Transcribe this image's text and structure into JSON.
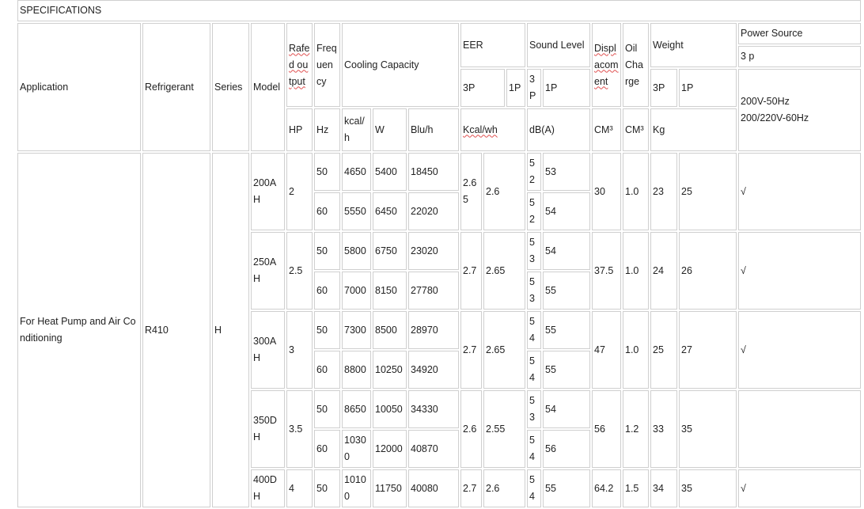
{
  "title": "SPECIFICATIONS",
  "headers": {
    "application": "Application",
    "refrigerant": "Refrigerant",
    "series": "Series",
    "model": "Model",
    "rated_output": "Rafed output",
    "frequency": "Frequency",
    "cooling_capacity": "Cooling Capacity",
    "eer": "EER",
    "eer_3p": "3P",
    "eer_1p": "1P",
    "sound_level": "Sound Level",
    "sound_3p": "3P",
    "sound_1p": "1P",
    "displacement": "Displacoment",
    "oil_charge": "Oil Charge",
    "weight": "Weight",
    "weight_3p": "3P",
    "weight_1p": "1P",
    "power_source": "Power Source",
    "power_phase": "3 p",
    "power_voltage_1": "200V-50Hz",
    "power_voltage_2": "200/220V-60Hz"
  },
  "units": {
    "hp": "HP",
    "hz": "Hz",
    "kcal": "kcal/h",
    "w": "W",
    "btu": "Blu/h",
    "eer": "Kcal/wh",
    "sound": "dB(A)",
    "displ": "CM³",
    "oil": "CM³",
    "weight": "Kg"
  },
  "application": "For Heat Pump and Air Conditioning",
  "refrigerant": "R410",
  "series": "H",
  "models": [
    {
      "model": "200AH",
      "hp": "2",
      "eer3": "2.65",
      "eer1": "2.6",
      "displ": "30",
      "oil": "1.0",
      "w3": "23",
      "w1": "25",
      "power": "√",
      "rows": [
        {
          "hz": "50",
          "kcal": "4650",
          "w": "5400",
          "btu": "18450",
          "s3": "52",
          "s1": "53"
        },
        {
          "hz": "60",
          "kcal": "5550",
          "w": "6450",
          "btu": "22020",
          "s3": "52",
          "s1": "54"
        }
      ]
    },
    {
      "model": "250AH",
      "hp": "2.5",
      "eer3": "2.7",
      "eer1": "2.65",
      "displ": "37.5",
      "oil": "1.0",
      "w3": "24",
      "w1": "26",
      "power": "√",
      "rows": [
        {
          "hz": "50",
          "kcal": "5800",
          "w": "6750",
          "btu": "23020",
          "s3": "53",
          "s1": "54"
        },
        {
          "hz": "60",
          "kcal": "7000",
          "w": "8150",
          "btu": "27780",
          "s3": "53",
          "s1": "55"
        }
      ]
    },
    {
      "model": "300AH",
      "hp": "3",
      "eer3": "2.7",
      "eer1": "2.65",
      "displ": "47",
      "oil": "1.0",
      "w3": "25",
      "w1": "27",
      "power": "√",
      "rows": [
        {
          "hz": "50",
          "kcal": "7300",
          "w": "8500",
          "btu": "28970",
          "s3": "54",
          "s1": "55"
        },
        {
          "hz": "60",
          "kcal": "8800",
          "w": "10250",
          "btu": "34920",
          "s3": "54",
          "s1": "55"
        }
      ]
    },
    {
      "model": "350DH",
      "hp": "3.5",
      "eer3": "2.6",
      "eer1": "2.55",
      "displ": "56",
      "oil": "1.2",
      "w3": "33",
      "w1": "35",
      "power": "",
      "rows": [
        {
          "hz": "50",
          "kcal": "8650",
          "w": "10050",
          "btu": "34330",
          "s3": "53",
          "s1": "54"
        },
        {
          "hz": "60",
          "kcal": "10300",
          "w": "12000",
          "btu": "40870",
          "s3": "54",
          "s1": "56"
        }
      ]
    },
    {
      "model": "400DH",
      "hp": "4",
      "eer3": "2.7",
      "eer1": "2.6",
      "displ": "64.2",
      "oil": "1.5",
      "w3": "34",
      "w1": "35",
      "power": "√",
      "rows": [
        {
          "hz": "50",
          "kcal": "10100",
          "w": "11750",
          "btu": "40080",
          "s3": "54",
          "s1": "55"
        }
      ]
    }
  ]
}
